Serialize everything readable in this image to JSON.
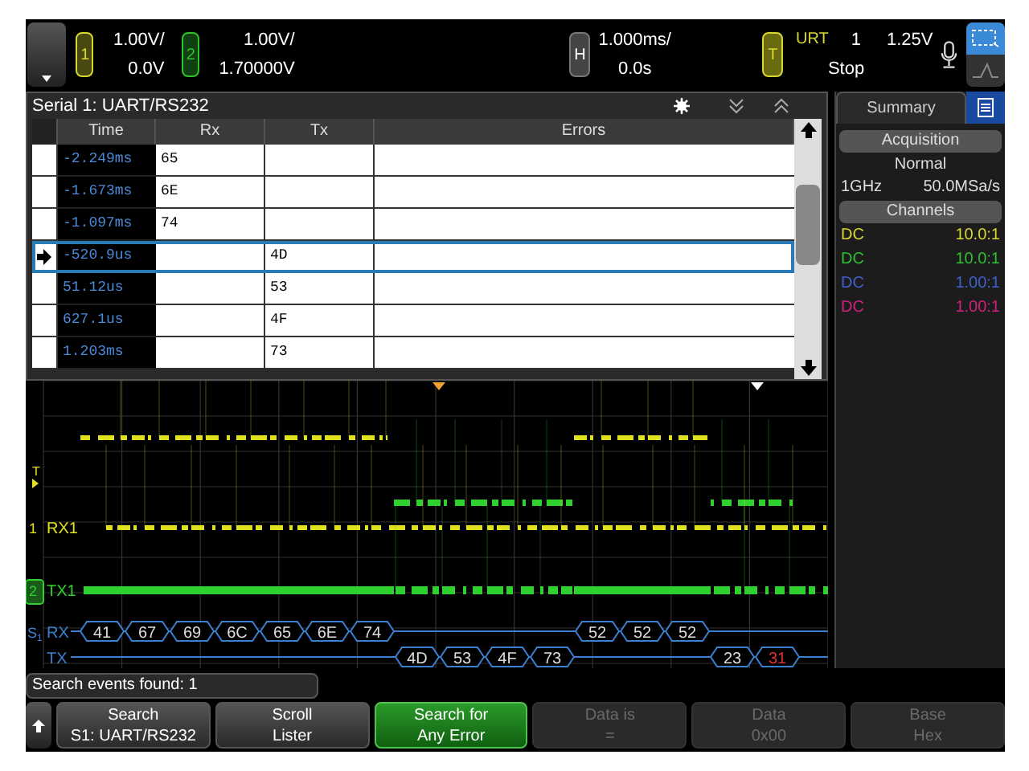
{
  "top_bar": {
    "channels": [
      {
        "label": "1",
        "scale": "1.00V/",
        "offset": "0.0V",
        "color": "#d8d830"
      },
      {
        "label": "2",
        "scale": "1.00V/",
        "offset": "1.70000V",
        "color": "#30c030"
      }
    ],
    "horizontal": {
      "label": "H",
      "scale": "1.000ms/",
      "delay": "0.0s"
    },
    "trigger": {
      "label": "T",
      "source": "URT",
      "channel": "1",
      "level": "1.25V",
      "state": "Stop"
    }
  },
  "lister": {
    "title": "Serial 1: UART/RS232",
    "columns": [
      "Time",
      "Rx",
      "Tx",
      "Errors"
    ],
    "rows": [
      {
        "time": "-2.249ms",
        "rx": "65",
        "tx": "",
        "selected": false
      },
      {
        "time": "-1.673ms",
        "rx": "6E",
        "tx": "",
        "selected": false
      },
      {
        "time": "-1.097ms",
        "rx": "74",
        "tx": "",
        "selected": false
      },
      {
        "time": "-520.9us",
        "rx": "",
        "tx": "4D",
        "selected": true
      },
      {
        "time": "51.12us",
        "rx": "",
        "tx": "53",
        "selected": false
      },
      {
        "time": "627.1us",
        "rx": "",
        "tx": "4F",
        "selected": false
      },
      {
        "time": "1.203ms",
        "rx": "",
        "tx": "73",
        "selected": false
      }
    ]
  },
  "summary": {
    "tab": "Summary",
    "acquisition": {
      "header": "Acquisition",
      "mode": "Normal",
      "bandwidth": "1GHz",
      "sample_rate": "50.0MSa/s"
    },
    "channels_header": "Channels",
    "channels": [
      {
        "coupling": "DC",
        "probe": "10.0:1",
        "color": "#d8d830"
      },
      {
        "coupling": "DC",
        "probe": "10.0:1",
        "color": "#30c030"
      },
      {
        "coupling": "DC",
        "probe": "1.00:1",
        "color": "#4060d0"
      },
      {
        "coupling": "DC",
        "probe": "1.00:1",
        "color": "#d02080"
      }
    ]
  },
  "waveform": {
    "trigger_label": "T",
    "ch1_label": "RX1",
    "ch1_number": "1",
    "ch2_label": "TX1",
    "ch2_number": "2",
    "bus_label": "S",
    "bus_index": "1",
    "rx_label": "RX",
    "tx_label": "TX",
    "packets": [
      {
        "kind": "rx",
        "value": "41",
        "error": false
      },
      {
        "kind": "rx",
        "value": "67",
        "error": false
      },
      {
        "kind": "rx",
        "value": "69",
        "error": false
      },
      {
        "kind": "rx",
        "value": "6C",
        "error": false
      },
      {
        "kind": "rx",
        "value": "65",
        "error": false
      },
      {
        "kind": "rx",
        "value": "6E",
        "error": false
      },
      {
        "kind": "rx",
        "value": "74",
        "error": false
      },
      {
        "kind": "tx",
        "value": "4D",
        "error": false
      },
      {
        "kind": "tx",
        "value": "53",
        "error": false
      },
      {
        "kind": "tx",
        "value": "4F",
        "error": false
      },
      {
        "kind": "tx",
        "value": "73",
        "error": false
      },
      {
        "kind": "rx",
        "value": "52",
        "error": false
      },
      {
        "kind": "rx",
        "value": "52",
        "error": false
      },
      {
        "kind": "rx",
        "value": "52",
        "error": false
      },
      {
        "kind": "tx",
        "value": "23",
        "error": false
      },
      {
        "kind": "tx",
        "value": "31",
        "error": true
      }
    ]
  },
  "search_status": "Search events found: 1",
  "softkeys": [
    {
      "top": "Search",
      "bottom": "S1: UART/RS232",
      "kind": "normal"
    },
    {
      "top": "Scroll",
      "bottom": "Lister",
      "kind": "normal"
    },
    {
      "top": "Search for",
      "bottom": "Any Error",
      "kind": "active"
    },
    {
      "top": "Data is",
      "bottom": "=",
      "kind": "disabled"
    },
    {
      "top": "Data",
      "bottom": "0x00",
      "kind": "disabled"
    },
    {
      "top": "Base",
      "bottom": "Hex",
      "kind": "disabled"
    }
  ]
}
